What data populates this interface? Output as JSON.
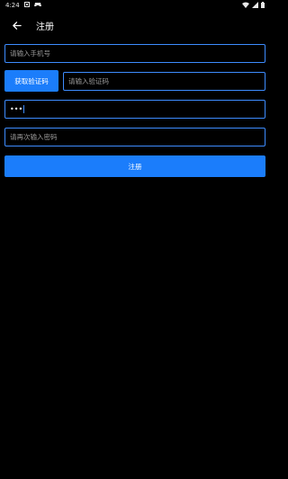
{
  "status_bar": {
    "time": "4:24",
    "icons": [
      "square-notification-icon",
      "controller-notification-icon",
      "wifi-icon",
      "signal-icon",
      "battery-icon"
    ]
  },
  "toolbar": {
    "title": "注册",
    "back_icon": "arrow-back-icon"
  },
  "form": {
    "phone_placeholder": "请输入手机号",
    "get_code_label": "获取验证码",
    "code_placeholder": "请输入验证码",
    "password_value": "•••",
    "confirm_placeholder": "请再次输入密码",
    "submit_label": "注册"
  },
  "colors": {
    "accent": "#1b7dfb",
    "field_border": "#3d8cff",
    "background": "#000000"
  }
}
